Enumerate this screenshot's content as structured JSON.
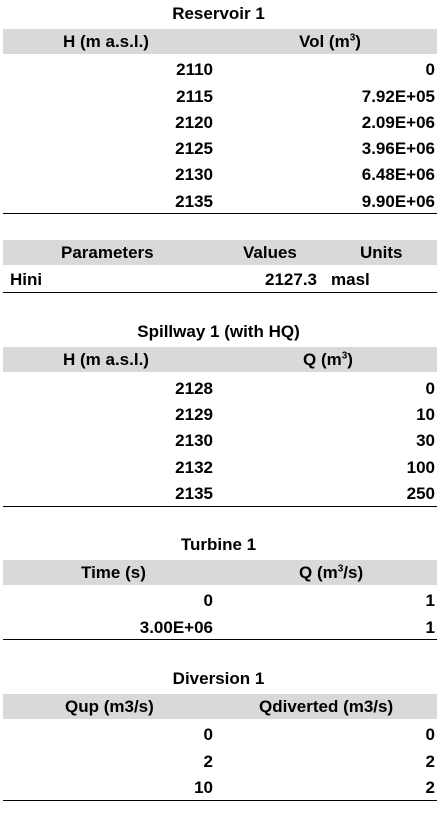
{
  "reservoir": {
    "title": "Reservoir 1",
    "col_h": "H (m a.s.l.)",
    "col_vol": "Vol (m",
    "col_vol_sup": "3",
    "col_vol_end": ")",
    "rows": [
      {
        "h": "2110",
        "v": "0"
      },
      {
        "h": "2115",
        "v": "7.92E+05"
      },
      {
        "h": "2120",
        "v": "2.09E+06"
      },
      {
        "h": "2125",
        "v": "3.96E+06"
      },
      {
        "h": "2130",
        "v": "6.48E+06"
      },
      {
        "h": "2135",
        "v": "9.90E+06"
      }
    ]
  },
  "parameters": {
    "col_param": "Parameters",
    "col_values": "Values",
    "col_units": "Units",
    "rows": [
      {
        "name": "Hini",
        "value": "2127.3",
        "unit": "masl"
      }
    ]
  },
  "spillway": {
    "title": "Spillway 1 (with HQ)",
    "col_h": "H (m a.s.l.)",
    "col_q": "Q (m",
    "col_q_sup": "3",
    "col_q_end": ")",
    "rows": [
      {
        "h": "2128",
        "q": "0"
      },
      {
        "h": "2129",
        "q": "10"
      },
      {
        "h": "2130",
        "q": "30"
      },
      {
        "h": "2132",
        "q": "100"
      },
      {
        "h": "2135",
        "q": "250"
      }
    ]
  },
  "turbine": {
    "title": "Turbine 1",
    "col_time": "Time (s)",
    "col_q": "Q (m",
    "col_q_sup": "3",
    "col_q_end": "/s)",
    "rows": [
      {
        "t": "0",
        "q": "1"
      },
      {
        "t": "3.00E+06",
        "q": "1"
      }
    ]
  },
  "diversion": {
    "title": "Diversion 1",
    "col_qup": "Qup (m3/s)",
    "col_qdiv": "Qdiverted (m3/s)",
    "rows": [
      {
        "qup": "0",
        "qd": "0"
      },
      {
        "qup": "2",
        "qd": "2"
      },
      {
        "qup": "10",
        "qd": "2"
      }
    ]
  }
}
